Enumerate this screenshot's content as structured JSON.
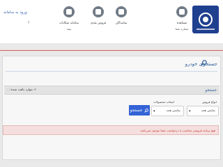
{
  "header": {
    "logo": "iran-khodro-logo",
    "login_link": "ورود به سامانه",
    "blank_marker": "؟",
    "nav": [
      {
        "id": "news",
        "label": "مشاهده",
        "sub": "شماره شما",
        "icon": "circle-icon"
      },
      {
        "id": "agencies",
        "label": "نمایندگان",
        "sub": "",
        "icon": "person-desk-icon"
      },
      {
        "id": "sales",
        "label": "فروش نقدی",
        "sub": "",
        "icon": "car-icon"
      },
      {
        "id": "complaints",
        "label": "سامانه شکایات",
        "sub": "بیمه",
        "icon": "shield-icon"
      }
    ]
  },
  "page": {
    "title": "جستجوی خودرو",
    "filter_title": "جستجو",
    "back_link": "موارد یافت شده: ۰ <",
    "fields": {
      "sale_type": {
        "label": "انواع فروش",
        "value": "نمایش همه"
      },
      "product": {
        "label": "انتخاب محصولات",
        "value": "نمایش همه"
      },
      "extra": {
        "value": "نمایش همه"
      }
    },
    "search_button": "جستجو",
    "alert": "هیچ برنامه فروشی متناسب با درخواست شما موجود نمی‌باشد"
  },
  "colors": {
    "brand": "#1f3f8f",
    "accent_link": "#2d5f9a",
    "primary_button": "#3463d6",
    "alert_bg": "#f5dede",
    "alert_text": "#c0392b",
    "top_rule": "#d65a5a"
  }
}
